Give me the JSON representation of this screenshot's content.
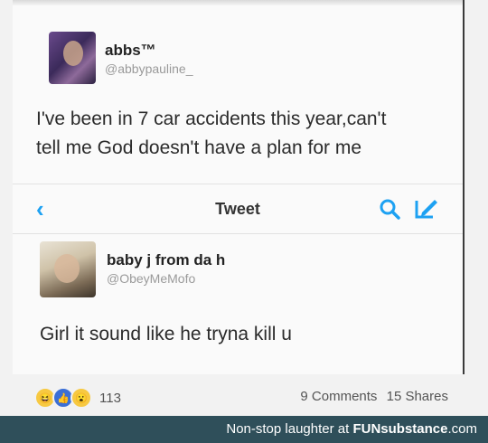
{
  "original_tweet": {
    "name": "abbs™",
    "handle": "@abbypauline_",
    "text_line1": "I've been in 7 car accidents this year,can't",
    "text_line2": "tell me God doesn't have a plan for me"
  },
  "navbar": {
    "back_icon": "chevron-left-icon",
    "title": "Tweet",
    "icons": [
      "search-icon",
      "compose-icon"
    ],
    "accent_color": "#1da1f2"
  },
  "reply_tweet": {
    "name": "baby j from da h",
    "handle": "@ObeyMeMofo",
    "text": "Girl it sound like he tryna kill u"
  },
  "footer": {
    "reaction_icons": [
      "haha-reaction-icon",
      "like-reaction-icon",
      "wow-reaction-icon"
    ],
    "reaction_count": "113",
    "comments": "9 Comments",
    "shares": "15 Shares"
  },
  "banner": {
    "text_prefix": "Non-stop laughter at ",
    "brand": "FUNsubstance",
    "suffix": ".com",
    "color": "#2f4f5a"
  }
}
